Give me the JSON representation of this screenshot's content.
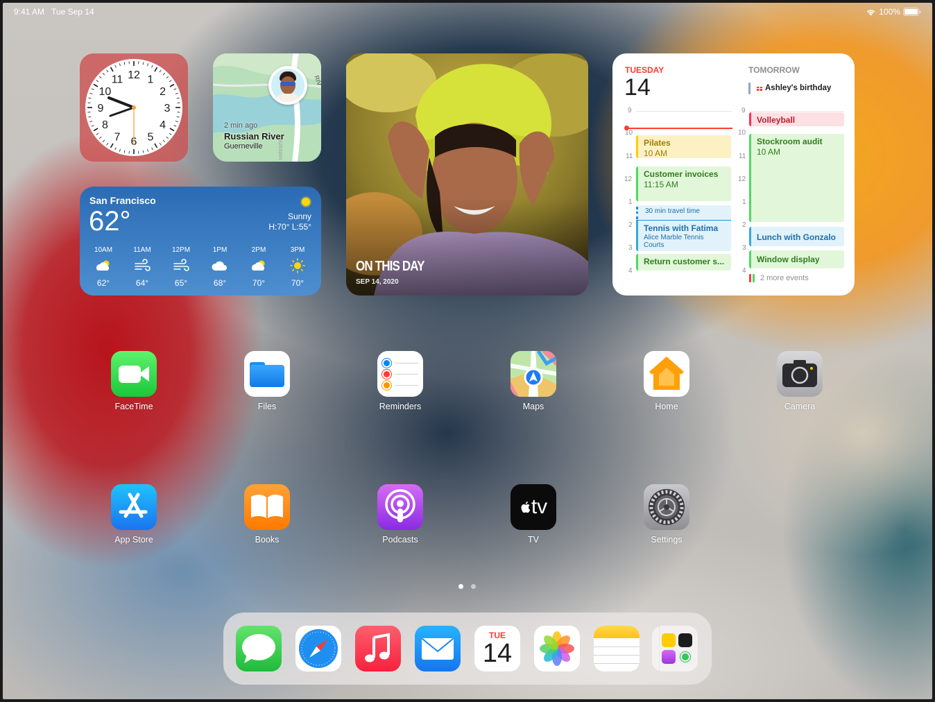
{
  "status_bar": {
    "time": "9:41 AM",
    "date": "Tue Sep 14",
    "battery": "100%"
  },
  "clock_widget": {
    "numbers": [
      "12",
      "1",
      "2",
      "3",
      "4",
      "5",
      "6",
      "7",
      "8",
      "9",
      "10",
      "11"
    ]
  },
  "maps_widget": {
    "road_label": "RIV",
    "road_label_2": "RUSSIAN",
    "time_ago": "2 min ago",
    "place": "Russian River",
    "town": "Guerneville"
  },
  "photo_widget": {
    "title": "ON THIS DAY",
    "date": "SEP 14, 2020"
  },
  "weather_widget": {
    "city": "San Francisco",
    "temp": "62°",
    "condition": "Sunny",
    "high_low": "H:70° L:55°",
    "hours": [
      {
        "time": "10AM",
        "icon": "partly-sunny-icon",
        "temp": "62°"
      },
      {
        "time": "11AM",
        "icon": "wind-icon",
        "temp": "64°"
      },
      {
        "time": "12PM",
        "icon": "wind-icon",
        "temp": "65°"
      },
      {
        "time": "1PM",
        "icon": "cloud-icon",
        "temp": "68°"
      },
      {
        "time": "2PM",
        "icon": "partly-sunny-icon",
        "temp": "70°"
      },
      {
        "time": "3PM",
        "icon": "sun-icon",
        "temp": "70°"
      }
    ]
  },
  "calendar_widget": {
    "today_label": "TUESDAY",
    "today_date": "14",
    "tomorrow_label": "TOMORROW",
    "birthday": "Ashley's birthday",
    "today_hours": [
      "9",
      "10",
      "11",
      "12",
      "1",
      "2",
      "3",
      "4"
    ],
    "tomorrow_hours": [
      "9",
      "10",
      "11",
      "12",
      "1",
      "2",
      "3",
      "4"
    ],
    "today_events": [
      {
        "title": "Pilates",
        "time": "10 AM"
      },
      {
        "title": "Customer invoices",
        "time": "11:15 AM"
      },
      {
        "title": "30 min travel time"
      },
      {
        "title": "Tennis with Fatima",
        "location": "Alice Marble Tennis Courts"
      },
      {
        "title": "Return customer s..."
      }
    ],
    "tomorrow_events": [
      {
        "title": "Volleyball"
      },
      {
        "title": "Stockroom audit",
        "time": "10 AM"
      },
      {
        "title": "Lunch with Gonzalo"
      },
      {
        "title": "Window display"
      }
    ],
    "more_events": "2 more events"
  },
  "apps": [
    {
      "label": "FaceTime",
      "icon": "facetime-icon"
    },
    {
      "label": "Files",
      "icon": "files-icon"
    },
    {
      "label": "Reminders",
      "icon": "reminders-icon"
    },
    {
      "label": "Maps",
      "icon": "maps-icon"
    },
    {
      "label": "Home",
      "icon": "home-icon"
    },
    {
      "label": "Camera",
      "icon": "camera-icon"
    },
    {
      "label": "App Store",
      "icon": "app-store-icon"
    },
    {
      "label": "Books",
      "icon": "books-icon"
    },
    {
      "label": "Podcasts",
      "icon": "podcasts-icon"
    },
    {
      "label": "TV",
      "icon": "tv-icon",
      "icon_text": "tv"
    },
    {
      "label": "Settings",
      "icon": "settings-icon"
    }
  ],
  "page_dots": {
    "count": 2,
    "current": 1
  },
  "dock": {
    "calendar_day": "TUE",
    "calendar_date": "14",
    "apps": [
      "messages-icon",
      "safari-icon",
      "music-icon",
      "mail-icon",
      "calendar-icon",
      "photos-icon",
      "notes-icon",
      "app-folder-icon"
    ]
  }
}
